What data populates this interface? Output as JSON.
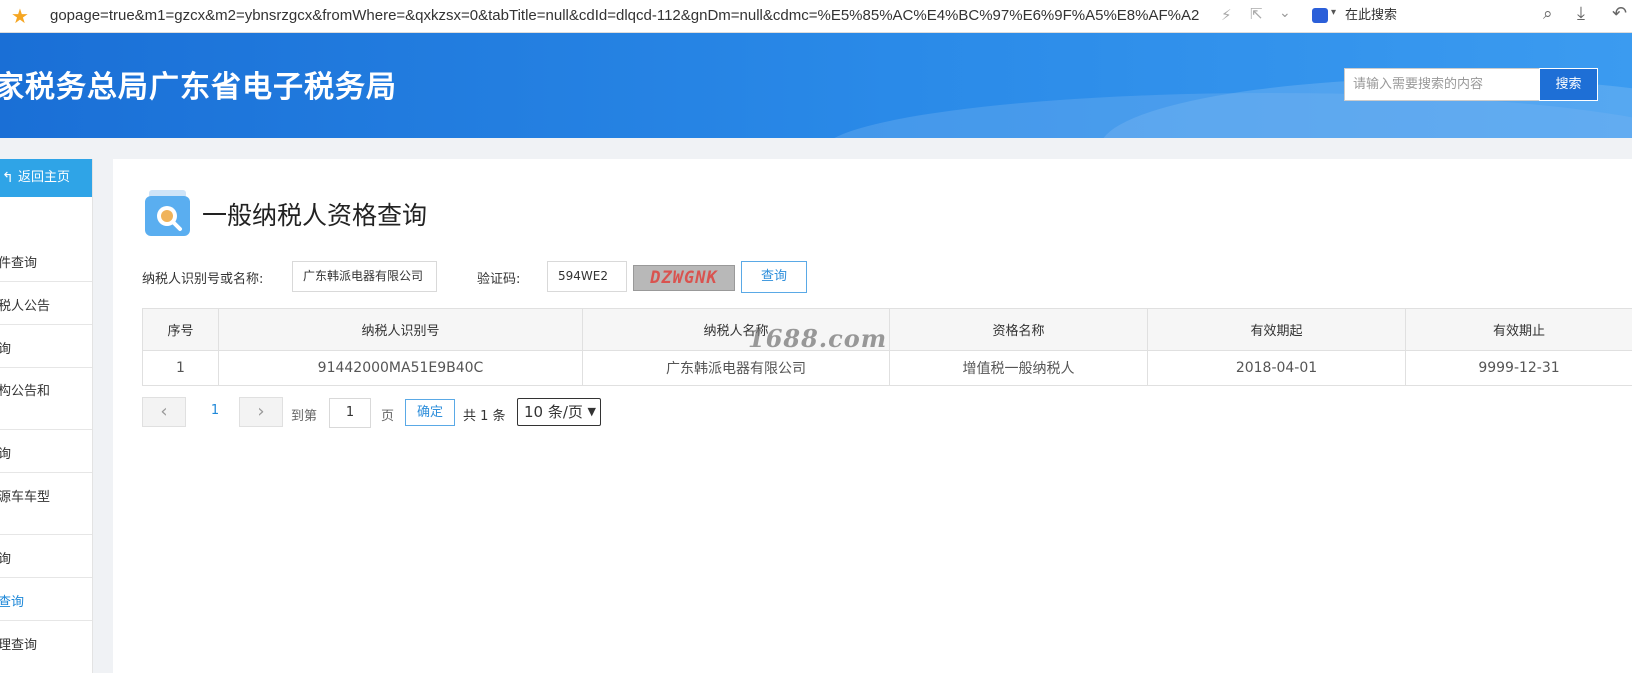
{
  "browser": {
    "url": "gopage=true&m1=gzcx&m2=ybnsrzgcx&fromWhere=&qxkzsx=0&tabTitle=null&cdId=dlqcd-112&gnDm=null&cdmc=%E5%85%AC%E4%BC%97%E6%9F%A5%E8%AF%A2",
    "search_label": "在此搜索"
  },
  "header": {
    "title": "家税务总局广东省电子税务局",
    "search_placeholder": "请输入需要搜索的内容",
    "search_button": "搜索"
  },
  "sidebar": {
    "home": "返回主页",
    "items": [
      "件查询",
      "税人公告",
      "询",
      "构公告和",
      "询",
      "源车车型",
      "询",
      "查询",
      "理查询"
    ],
    "active_index": 7
  },
  "page": {
    "title": "一般纳税人资格查询",
    "form": {
      "taxpayer_label": "纳税人识别号或名称:",
      "taxpayer_value": "广东韩派电器有限公司",
      "captcha_label": "验证码:",
      "captcha_value": "594WE2",
      "captcha_image_text": "DZWGNK",
      "query_button": "查询"
    },
    "table": {
      "columns": [
        "序号",
        "纳税人识别号",
        "纳税人名称",
        "资格名称",
        "有效期起",
        "有效期止"
      ],
      "rows": [
        [
          "1",
          "91442000MA51E9B40C",
          "广东韩派电器有限公司",
          "增值税一般纳税人",
          "2018-04-01",
          "9999-12-31"
        ]
      ]
    },
    "watermark": "1688.com",
    "pagination": {
      "prev": "‹",
      "current_page": "1",
      "next": "›",
      "goto_label": "到第",
      "goto_value": "1",
      "page_suffix": "页",
      "confirm": "确定",
      "total": "共 1 条",
      "page_size": "10 条/页"
    }
  }
}
